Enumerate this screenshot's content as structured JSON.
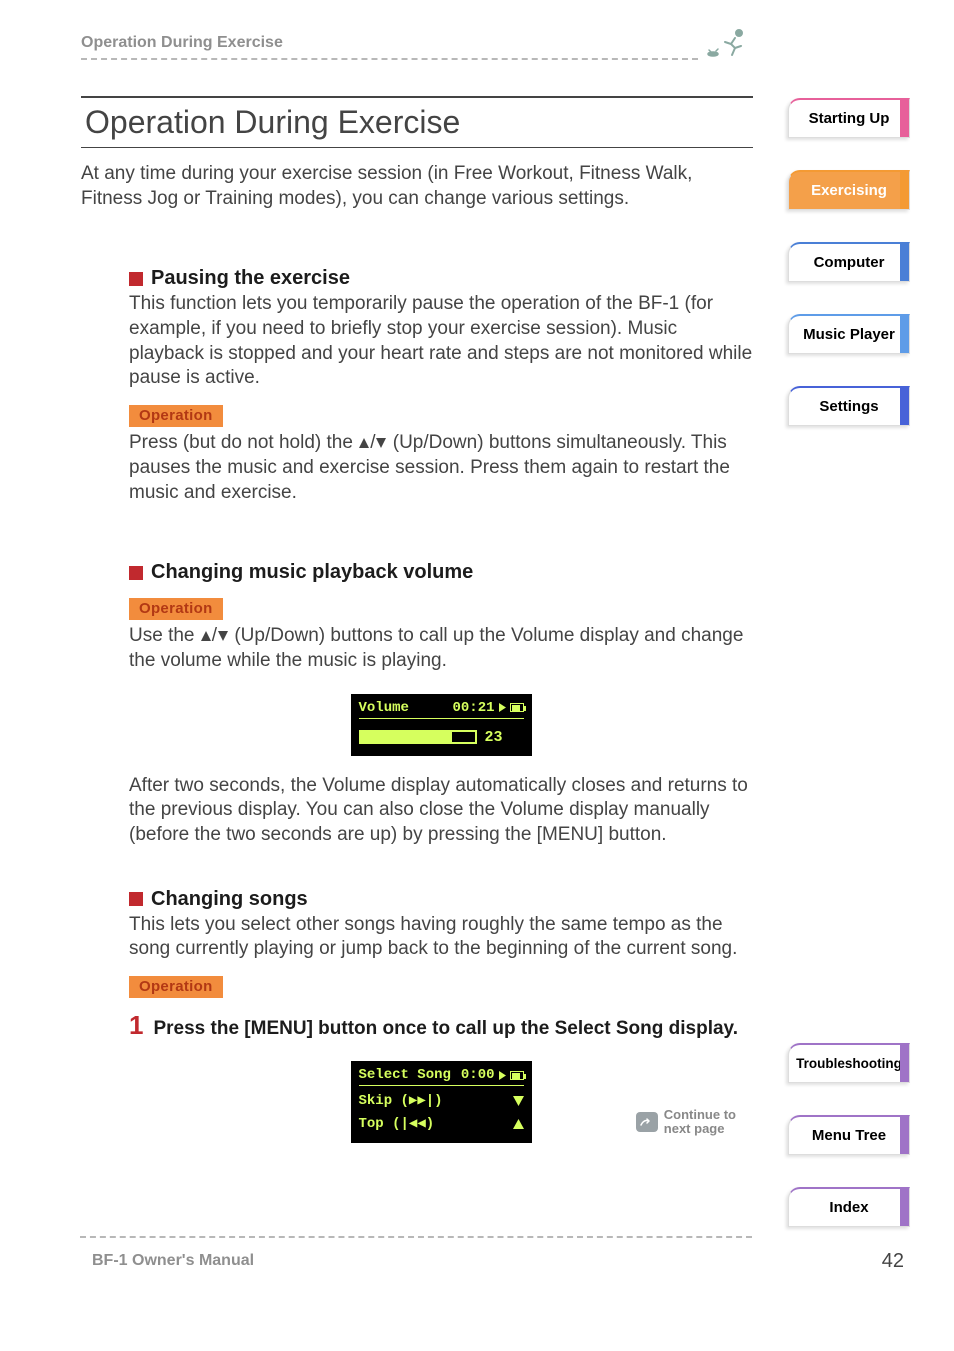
{
  "header": {
    "breadcrumb": "Operation During Exercise"
  },
  "page": {
    "title": "Operation During Exercise",
    "intro": "At any time during your exercise session (in Free Workout, Fitness Walk, Fitness Jog or Training modes), you can change various settings."
  },
  "operation_label": "Operation",
  "sections": {
    "pausing": {
      "title": "Pausing the exercise",
      "body": "This function lets you temporarily pause the operation of the BF-1 (for example, if you need to briefly stop your exercise session). Music playback is stopped and your heart rate and steps are not monitored while pause is active.",
      "op_pre": "Press (but do not hold) the ",
      "op_post": " (Up/Down) buttons simultaneously. This pauses the music and exercise session. Press them again to restart the music and exercise."
    },
    "volume": {
      "title": "Changing music playback volume",
      "op_pre": "Use the ",
      "op_post": " (Up/Down) buttons to call up the Volume display and change the volume while the music is playing.",
      "after": "After two seconds, the Volume display automatically closes and returns to the previous display. You can also close the Volume display manually (before the two seconds are up) by pressing the [MENU] button."
    },
    "songs": {
      "title": "Changing songs",
      "body": "This lets you select other songs having roughly the same tempo as the song currently playing or jump back to the beginning of the current song.",
      "step_num": "1",
      "step_text": "Press the [MENU] button once to call up the Select Song display."
    }
  },
  "lcd_volume": {
    "label": "Volume",
    "time": "00:21",
    "value": "23"
  },
  "lcd_select": {
    "header": "Select Song",
    "time": "0:00",
    "row1": "Skip (▶▶|)",
    "row2": "Top (|◀◀)"
  },
  "continue_text": "Continue to\nnext page",
  "footer": {
    "manual": "BF-1 Owner's Manual",
    "page": "42"
  },
  "tabs_top": [
    {
      "label": "Starting Up",
      "color": "pink"
    },
    {
      "label": "Exercising",
      "color": "orange"
    },
    {
      "label": "Computer",
      "color": "blue"
    },
    {
      "label": "Music Player",
      "color": "ltblue"
    },
    {
      "label": "Settings",
      "color": "royal"
    }
  ],
  "tabs_bottom": [
    {
      "label": "Troubleshooting",
      "color": "purple"
    },
    {
      "label": "Menu Tree",
      "color": "purple"
    },
    {
      "label": "Index",
      "color": "purple"
    }
  ]
}
